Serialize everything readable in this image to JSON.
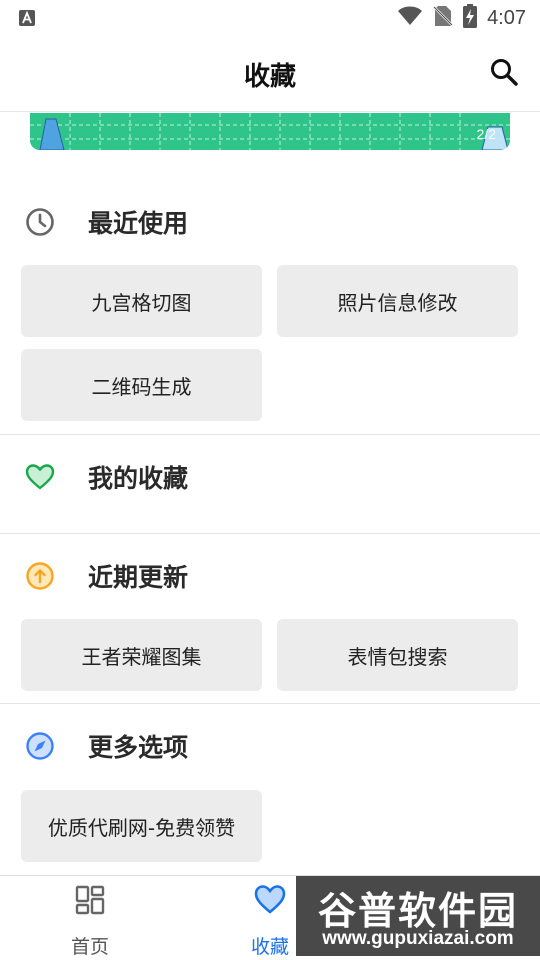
{
  "status_bar": {
    "time": "4:07",
    "icons": [
      "font-a-icon",
      "wifi-icon",
      "no-sim-icon",
      "battery-charging-icon"
    ]
  },
  "header": {
    "title": "收藏",
    "search_icon": "search-icon"
  },
  "banner": {
    "indicator": "2/2",
    "color": "#2ec48a"
  },
  "sections": {
    "recent": {
      "title": "最近使用",
      "icon": "clock-icon",
      "items": [
        "九宫格切图",
        "照片信息修改",
        "二维码生成"
      ]
    },
    "favorites": {
      "title": "我的收藏",
      "icon": "heart-icon",
      "icon_color": "#1aa64b",
      "items": []
    },
    "updates": {
      "title": "近期更新",
      "icon": "arrow-up-circle-icon",
      "icon_color": "#f5a623",
      "items": [
        "王者荣耀图集",
        "表情包搜索"
      ]
    },
    "more": {
      "title": "更多选项",
      "icon": "compass-icon",
      "icon_color": "#3b82f6",
      "items": [
        "优质代刷网-免费领赞"
      ]
    }
  },
  "bottom_nav": {
    "items": [
      {
        "label": "首页",
        "icon": "grid-icon",
        "active": false
      },
      {
        "label": "收藏",
        "icon": "heart-icon",
        "active": true
      }
    ],
    "active_color": "#1a73e8",
    "inactive_color": "#555555"
  },
  "watermark": {
    "title": "谷普软件园",
    "url": "www.gupuxiazai.com"
  }
}
